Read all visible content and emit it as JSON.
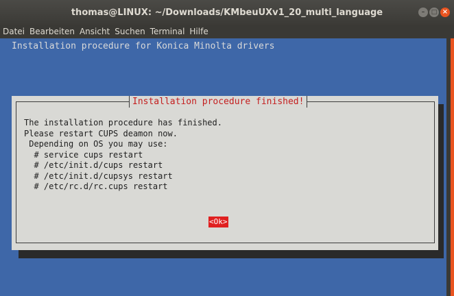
{
  "window": {
    "title": "thomas@LINUX: ~/Downloads/KMbeuUXv1_20_multi_language",
    "buttons": {
      "minimize": "–",
      "maximize": "□",
      "close": "×"
    }
  },
  "menubar": {
    "items": [
      "Datei",
      "Bearbeiten",
      "Ansicht",
      "Suchen",
      "Terminal",
      "Hilfe"
    ]
  },
  "terminal": {
    "backtitle": "Installation procedure for Konica Minolta drivers"
  },
  "dialog": {
    "title": "Installation procedure finished!",
    "lines": [
      "The installation procedure has finished.",
      "Please restart CUPS deamon now.",
      " Depending on OS you may use:",
      "  # service cups restart",
      "  # /etc/init.d/cups restart",
      "  # /etc/init.d/cupsys restart",
      "  # /etc/rc.d/rc.cups restart"
    ],
    "ok_label": "<Ok>"
  },
  "colors": {
    "terminal_bg": "#3e67a8",
    "dialog_bg": "#d9d9d5",
    "title_red": "#c41e1e",
    "ok_bg": "#e02020",
    "ubuntu_orange": "#e95420"
  }
}
